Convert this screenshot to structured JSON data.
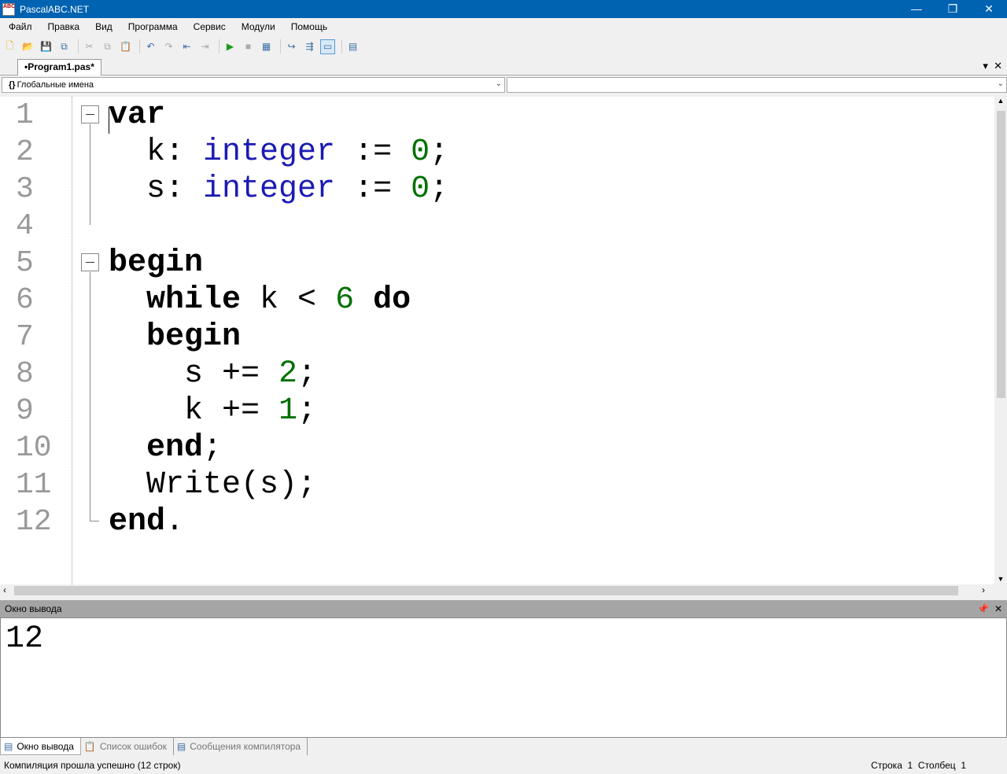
{
  "window": {
    "title": "PascalABC.NET",
    "icon_text": "ABC"
  },
  "menu": [
    "Файл",
    "Правка",
    "Вид",
    "Программа",
    "Сервис",
    "Модули",
    "Помощь"
  ],
  "toolbar": [
    "new-file",
    "open",
    "save",
    "save-all",
    "cut",
    "copy",
    "paste",
    "undo",
    "redo",
    "back",
    "forward",
    "run",
    "stop",
    "compile",
    "step-into",
    "step-over",
    "output-window",
    "debug-window"
  ],
  "tab": {
    "label": "•Program1.pas*"
  },
  "scope_combo": {
    "value": "Глобальные имена",
    "icon": "{}"
  },
  "member_combo": {
    "value": ""
  },
  "editor": {
    "line_numbers": [
      "1",
      "2",
      "3",
      "4",
      "5",
      "6",
      "7",
      "8",
      "9",
      "10",
      "11",
      "12"
    ],
    "lines": [
      [
        {
          "t": "var",
          "c": "kw"
        }
      ],
      [
        {
          "t": "  k: ",
          "c": "tx"
        },
        {
          "t": "integer",
          "c": "ty"
        },
        {
          "t": " := ",
          "c": "tx"
        },
        {
          "t": "0",
          "c": "nm"
        },
        {
          "t": ";",
          "c": "tx"
        }
      ],
      [
        {
          "t": "  s: ",
          "c": "tx"
        },
        {
          "t": "integer",
          "c": "ty"
        },
        {
          "t": " := ",
          "c": "tx"
        },
        {
          "t": "0",
          "c": "nm"
        },
        {
          "t": ";",
          "c": "tx"
        }
      ],
      [],
      [
        {
          "t": "begin",
          "c": "kw"
        }
      ],
      [
        {
          "t": "  ",
          "c": "tx"
        },
        {
          "t": "while",
          "c": "kw"
        },
        {
          "t": " k < ",
          "c": "tx"
        },
        {
          "t": "6",
          "c": "nm"
        },
        {
          "t": " ",
          "c": "tx"
        },
        {
          "t": "do",
          "c": "kw"
        }
      ],
      [
        {
          "t": "  ",
          "c": "tx"
        },
        {
          "t": "begin",
          "c": "kw"
        }
      ],
      [
        {
          "t": "    s += ",
          "c": "tx"
        },
        {
          "t": "2",
          "c": "nm"
        },
        {
          "t": ";",
          "c": "tx"
        }
      ],
      [
        {
          "t": "    k += ",
          "c": "tx"
        },
        {
          "t": "1",
          "c": "nm"
        },
        {
          "t": ";",
          "c": "tx"
        }
      ],
      [
        {
          "t": "  ",
          "c": "tx"
        },
        {
          "t": "end",
          "c": "kw"
        },
        {
          "t": ";",
          "c": "tx"
        }
      ],
      [
        {
          "t": "  Write(s);",
          "c": "tx"
        }
      ],
      [
        {
          "t": "end",
          "c": "kw"
        },
        {
          "t": ".",
          "c": "tx"
        }
      ]
    ]
  },
  "output": {
    "title": "Окно вывода",
    "text": "12"
  },
  "bottom_tabs": [
    {
      "label": "Окно вывода"
    },
    {
      "label": "Список ошибок"
    },
    {
      "label": "Сообщения компилятора"
    }
  ],
  "status": {
    "message": "Компиляция прошла успешно (12 строк)",
    "row_label": "Строка",
    "row": "1",
    "col_label": "Столбец",
    "col": "1"
  },
  "colors": {
    "titlebar": "#0063b1",
    "keyword": "#000000",
    "type": "#1b1bb3",
    "number": "#007000"
  }
}
